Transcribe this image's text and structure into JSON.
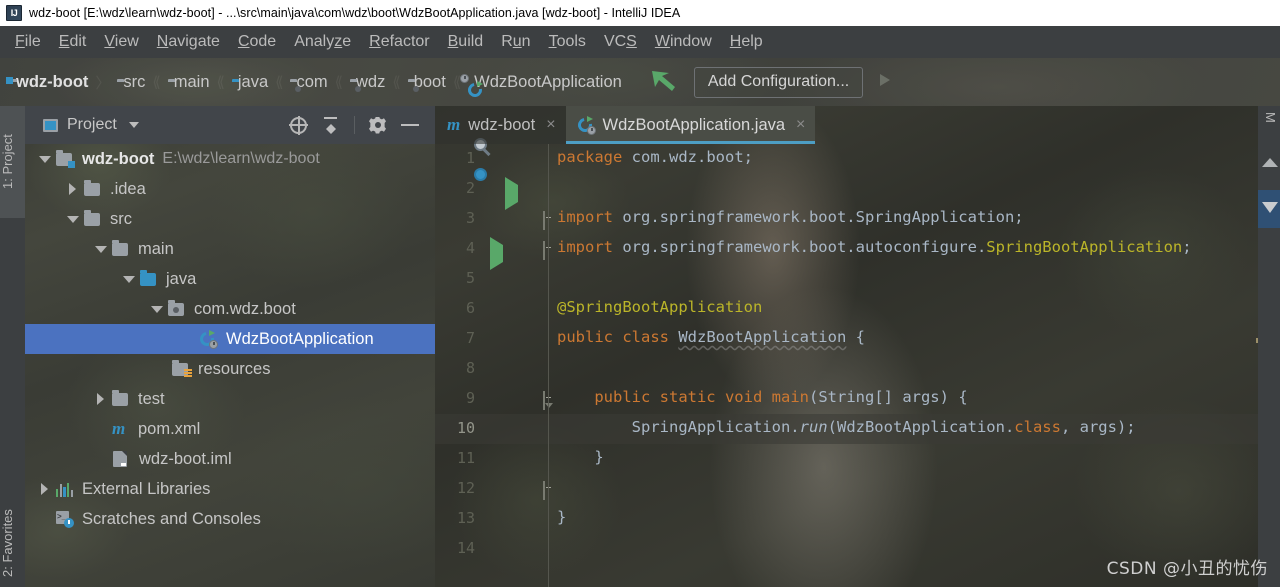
{
  "window": {
    "logo_text": "IJ",
    "title": "wdz-boot [E:\\wdz\\learn\\wdz-boot] - ...\\src\\main\\java\\com\\wdz\\boot\\WdzBootApplication.java [wdz-boot] - IntelliJ IDEA"
  },
  "menubar": {
    "items": [
      {
        "label": "File",
        "mnemonic": "F"
      },
      {
        "label": "Edit",
        "mnemonic": "E"
      },
      {
        "label": "View",
        "mnemonic": "V"
      },
      {
        "label": "Navigate",
        "mnemonic": "N"
      },
      {
        "label": "Code",
        "mnemonic": "C"
      },
      {
        "label": "Analyze",
        "mnemonic": "z"
      },
      {
        "label": "Refactor",
        "mnemonic": "R"
      },
      {
        "label": "Build",
        "mnemonic": "B"
      },
      {
        "label": "Run",
        "mnemonic": "u"
      },
      {
        "label": "Tools",
        "mnemonic": "T"
      },
      {
        "label": "VCS",
        "mnemonic": "S"
      },
      {
        "label": "Window",
        "mnemonic": "W"
      },
      {
        "label": "Help",
        "mnemonic": "H"
      }
    ]
  },
  "navbar": {
    "crumbs": [
      {
        "label": "wdz-boot",
        "icon": "module-folder-icon",
        "bold": true
      },
      {
        "label": "src",
        "icon": "folder-icon",
        "bold": false
      },
      {
        "label": "main",
        "icon": "folder-icon",
        "bold": false
      },
      {
        "label": "java",
        "icon": "source-folder-icon",
        "bold": false
      },
      {
        "label": "com",
        "icon": "package-folder-icon",
        "bold": false
      },
      {
        "label": "wdz",
        "icon": "package-folder-icon",
        "bold": false
      },
      {
        "label": "boot",
        "icon": "package-folder-icon",
        "bold": false
      },
      {
        "label": "WdzBootApplication",
        "icon": "spring-boot-class-icon",
        "bold": false
      }
    ],
    "separator": "〉",
    "add_configuration_label": "Add Configuration...",
    "accent_green": "#59a869"
  },
  "left_strip": {
    "project_label": "1: Project",
    "favorites_label": "2: Favorites"
  },
  "project_panel": {
    "title": "Project",
    "toolbar": [
      "locate-icon",
      "collapse-all-icon",
      "settings-gear-icon",
      "hide-icon"
    ],
    "selection_color": "#4b72c0",
    "tree": [
      {
        "label": "wdz-boot",
        "path": "E:\\wdz\\learn\\wdz-boot",
        "indent": 0,
        "twist": "down",
        "icon": "module-folder-icon",
        "bold": true,
        "selected": false
      },
      {
        "label": ".idea",
        "path": "",
        "indent": 1,
        "twist": "right",
        "icon": "folder-icon",
        "bold": false,
        "selected": false
      },
      {
        "label": "src",
        "path": "",
        "indent": 1,
        "twist": "down",
        "icon": "folder-icon",
        "bold": false,
        "selected": false
      },
      {
        "label": "main",
        "path": "",
        "indent": 2,
        "twist": "down",
        "icon": "folder-icon",
        "bold": false,
        "selected": false
      },
      {
        "label": "java",
        "path": "",
        "indent": 3,
        "twist": "down",
        "icon": "source-folder-icon",
        "bold": false,
        "selected": false
      },
      {
        "label": "com.wdz.boot",
        "path": "",
        "indent": 4,
        "twist": "down",
        "icon": "package-folder-icon",
        "bold": false,
        "selected": false
      },
      {
        "label": "WdzBootApplication",
        "path": "",
        "indent": 5,
        "twist": "none",
        "icon": "spring-boot-class-icon",
        "bold": false,
        "selected": true
      },
      {
        "label": "resources",
        "path": "",
        "indent": 4,
        "twist": "none",
        "icon": "resources-folder-icon",
        "bold": false,
        "selected": false
      },
      {
        "label": "test",
        "path": "",
        "indent": 2,
        "twist": "right",
        "icon": "folder-icon",
        "bold": false,
        "selected": false
      },
      {
        "label": "pom.xml",
        "path": "",
        "indent": 2,
        "twist": "none",
        "icon": "maven-icon",
        "bold": false,
        "selected": false
      },
      {
        "label": "wdz-boot.iml",
        "path": "",
        "indent": 2,
        "twist": "none",
        "icon": "iml-file-icon",
        "bold": false,
        "selected": false
      },
      {
        "label": "External Libraries",
        "path": "",
        "indent": 0,
        "twist": "right",
        "icon": "external-libraries-icon",
        "bold": false,
        "selected": false
      },
      {
        "label": "Scratches and Consoles",
        "path": "",
        "indent": 0,
        "twist": "none",
        "icon": "scratches-icon",
        "bold": false,
        "selected": false
      }
    ]
  },
  "editor": {
    "tabs": [
      {
        "label": "wdz-boot",
        "icon": "maven-icon",
        "active": false,
        "close": "×"
      },
      {
        "label": "WdzBootApplication.java",
        "icon": "spring-boot-class-icon",
        "active": true,
        "close": "×"
      }
    ],
    "active_tab_underline": "#4d9ec4",
    "caret_line": 10,
    "lines": [
      {
        "n": 1,
        "text": "package com.wdz.boot;"
      },
      {
        "n": 2,
        "text": ""
      },
      {
        "n": 3,
        "text": "import org.springframework.boot.SpringApplication;"
      },
      {
        "n": 4,
        "text": "import org.springframework.boot.autoconfigure.SpringBootApplication;"
      },
      {
        "n": 5,
        "text": ""
      },
      {
        "n": 6,
        "text": "@SpringBootApplication"
      },
      {
        "n": 7,
        "text": "public class WdzBootApplication {"
      },
      {
        "n": 8,
        "text": ""
      },
      {
        "n": 9,
        "text": "    public static void main(String[] args) {"
      },
      {
        "n": 10,
        "text": "        SpringApplication.run(WdzBootApplication.class, args);"
      },
      {
        "n": 11,
        "text": "    }"
      },
      {
        "n": 12,
        "text": ""
      },
      {
        "n": 13,
        "text": "}"
      },
      {
        "n": 14,
        "text": ""
      }
    ],
    "gutter_icons": [
      {
        "line": 6,
        "icon": "spring-bean-search-icon"
      },
      {
        "line": 7,
        "icon": "spring-bean-icon"
      },
      {
        "line": 7,
        "icon": "run-class-icon"
      },
      {
        "line": 9,
        "icon": "run-method-icon"
      }
    ],
    "colors": {
      "keyword": "#cc7832",
      "annotation": "#bbb529",
      "identifier": "#a9b7c6",
      "background": "#2e2f2b"
    }
  },
  "right_strip": {
    "maven_label": "M"
  },
  "watermark": {
    "text": "CSDN @小丑的忧伤"
  }
}
